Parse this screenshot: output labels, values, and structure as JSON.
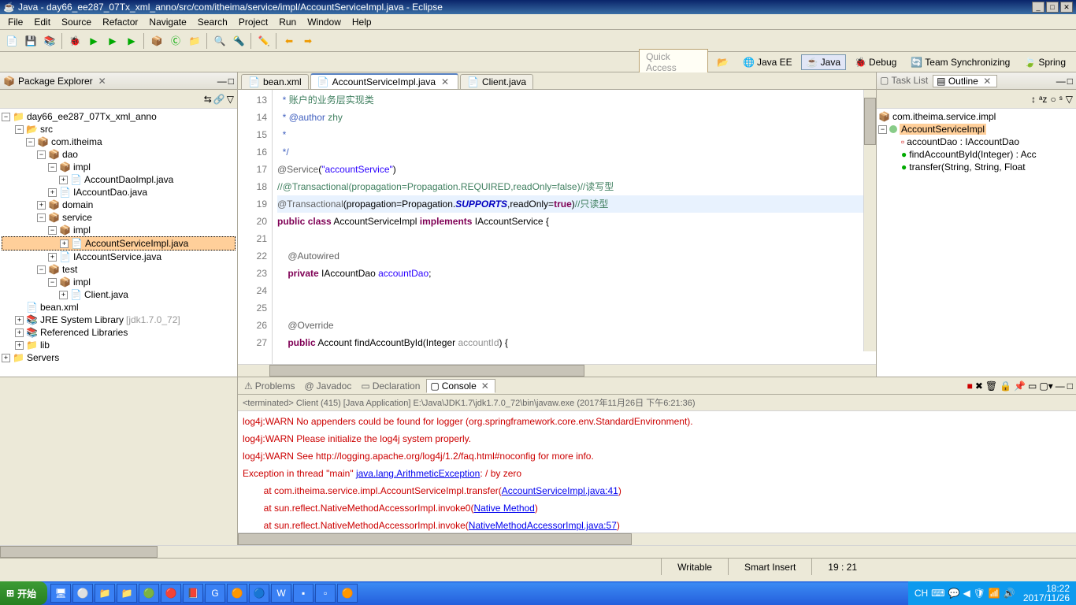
{
  "window": {
    "title": "Java - day66_ee287_07Tx_xml_anno/src/com/itheima/service/impl/AccountServiceImpl.java - Eclipse"
  },
  "menu": [
    "File",
    "Edit",
    "Source",
    "Refactor",
    "Navigate",
    "Search",
    "Project",
    "Run",
    "Window",
    "Help"
  ],
  "perspective": {
    "quick_access": "Quick Access",
    "items": [
      "Java EE",
      "Java",
      "Debug",
      "Team Synchronizing",
      "Spring"
    ],
    "active": "Java"
  },
  "package_explorer": {
    "title": "Package Explorer",
    "project": "day66_ee287_07Tx_xml_anno",
    "nodes": {
      "src": "src",
      "pkg": "com.itheima",
      "dao": "dao",
      "dao_impl": "impl",
      "dao_impl_file": "AccountDaoImpl.java",
      "dao_iface": "IAccountDao.java",
      "domain": "domain",
      "service": "service",
      "service_impl": "impl",
      "service_impl_file": "AccountServiceImpl.java",
      "service_iface": "IAccountService.java",
      "test": "test",
      "test_impl": "impl",
      "client": "Client.java",
      "bean": "bean.xml",
      "jre": "JRE System Library",
      "jre_ver": "[jdk1.7.0_72]",
      "ref": "Referenced Libraries",
      "lib": "lib",
      "servers": "Servers"
    }
  },
  "editor": {
    "tabs": [
      {
        "label": "bean.xml"
      },
      {
        "label": "AccountServiceImpl.java"
      },
      {
        "label": "Client.java"
      }
    ],
    "active_tab": 1,
    "first_line": 13,
    "lines": [
      {
        "indent": " ",
        "tokens": [
          {
            "t": " *",
            "c": "c-tag"
          },
          {
            "t": " 账户的业务层实现类",
            "c": "c-comment"
          }
        ]
      },
      {
        "indent": " ",
        "tokens": [
          {
            "t": " *",
            "c": "c-tag"
          },
          {
            "t": " @author",
            "c": "c-tag"
          },
          {
            "t": " zhy",
            "c": "c-comment"
          }
        ]
      },
      {
        "indent": " ",
        "tokens": [
          {
            "t": " *",
            "c": "c-tag"
          }
        ]
      },
      {
        "indent": " ",
        "tokens": [
          {
            "t": " */",
            "c": "c-tag"
          }
        ]
      },
      {
        "indent": "",
        "tokens": [
          {
            "t": "@Service",
            "c": "c-ann"
          },
          {
            "t": "(",
            "c": ""
          },
          {
            "t": "\"accountService\"",
            "c": "c-str"
          },
          {
            "t": ")",
            "c": ""
          }
        ]
      },
      {
        "indent": "",
        "tokens": [
          {
            "t": "//@Transactional(propagation=Propagation.REQUIRED,readOnly=false)//读写型",
            "c": "c-comment"
          }
        ]
      },
      {
        "indent": "",
        "hl": true,
        "tokens": [
          {
            "t": "@Transactional",
            "c": "c-ann"
          },
          {
            "t": "(propagation=Propagation.",
            "c": ""
          },
          {
            "t": "SUPPORTS",
            "c": "c-boldblue"
          },
          {
            "t": ",readOnly=",
            "c": ""
          },
          {
            "t": "true",
            "c": "c-key"
          },
          {
            "t": ")",
            "c": ""
          },
          {
            "t": "//只读型",
            "c": "c-comment"
          }
        ]
      },
      {
        "indent": "",
        "tokens": [
          {
            "t": "public",
            "c": "c-key"
          },
          {
            "t": " ",
            "c": ""
          },
          {
            "t": "class",
            "c": "c-key"
          },
          {
            "t": " AccountServiceImpl ",
            "c": ""
          },
          {
            "t": "implements",
            "c": "c-key"
          },
          {
            "t": " IAccountService {",
            "c": ""
          }
        ]
      },
      {
        "indent": "",
        "tokens": []
      },
      {
        "indent": "    ",
        "tokens": [
          {
            "t": "@Autowired",
            "c": "c-ann"
          }
        ]
      },
      {
        "indent": "    ",
        "tokens": [
          {
            "t": "private",
            "c": "c-key"
          },
          {
            "t": " IAccountDao ",
            "c": ""
          },
          {
            "t": "accountDao",
            "c": "c-str"
          },
          {
            "t": ";",
            "c": ""
          }
        ]
      },
      {
        "indent": "",
        "tokens": []
      },
      {
        "indent": "",
        "tokens": []
      },
      {
        "indent": "    ",
        "tokens": [
          {
            "t": "@Override",
            "c": "c-ann"
          }
        ]
      },
      {
        "indent": "    ",
        "tokens": [
          {
            "t": "public",
            "c": "c-key"
          },
          {
            "t": " Account findAccountById(Integer ",
            "c": ""
          },
          {
            "t": "accountId",
            "c": "c-lite"
          },
          {
            "t": ") {",
            "c": ""
          }
        ]
      }
    ]
  },
  "outline": {
    "tabs": [
      "Task List",
      "Outline"
    ],
    "pkg": "com.itheima.service.impl",
    "cls": "AccountServiceImpl",
    "members": [
      {
        "label": "accountDao : IAccountDao"
      },
      {
        "label": "findAccountById(Integer) : Acc"
      },
      {
        "label": "transfer(String, String, Float"
      }
    ]
  },
  "bottom": {
    "tabs": [
      "Problems",
      "Javadoc",
      "Declaration",
      "Console"
    ],
    "active": "Console",
    "header": "<terminated> Client (415) [Java Application] E:\\Java\\JDK1.7\\jdk1.7.0_72\\bin\\javaw.exe (2017年11月26日 下午6:21:36)",
    "lines": [
      "log4j:WARN No appenders could be found for logger (org.springframework.core.env.StandardEnvironment).",
      "log4j:WARN Please initialize the log4j system properly.",
      "log4j:WARN See http://logging.apache.org/log4j/1.2/faq.html#noconfig for more info."
    ],
    "ex_pre": "Exception in thread \"main\" ",
    "ex_link": "java.lang.ArithmeticException",
    "ex_post": ": / by zero",
    "trace": [
      {
        "pre": "        at com.itheima.service.impl.AccountServiceImpl.transfer(",
        "link": "AccountServiceImpl.java:41",
        "post": ")"
      },
      {
        "pre": "        at sun.reflect.NativeMethodAccessorImpl.invoke0(",
        "link": "Native Method",
        "post": ")"
      },
      {
        "pre": "        at sun.reflect.NativeMethodAccessorImpl.invoke(",
        "link": "NativeMethodAccessorImpl.java:57",
        "post": ")"
      }
    ]
  },
  "status": {
    "writable": "Writable",
    "mode": "Smart Insert",
    "pos": "19 : 21"
  },
  "taskbar": {
    "start": "开始",
    "lang": "CH",
    "time": "18:22",
    "date": "2017/11/26"
  }
}
